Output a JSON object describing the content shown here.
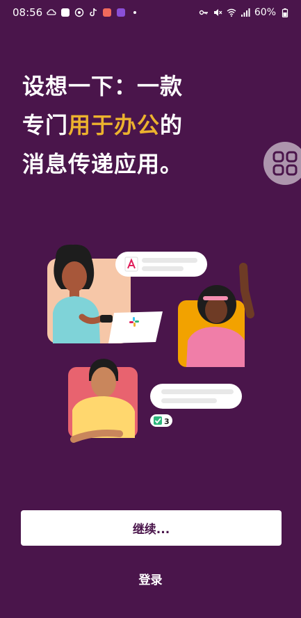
{
  "status_bar": {
    "time": "08:56",
    "battery_percent": "60%",
    "notification_icons": [
      "cloud-icon",
      "mail-icon",
      "chrome-icon",
      "tiktok-icon",
      "app-icon",
      "shield-icon",
      "dot-icon"
    ],
    "system_icons": [
      "key-icon",
      "mute-icon",
      "wifi-icon",
      "signal-icon",
      "battery-icon"
    ]
  },
  "headline": {
    "line1": "设想一下：一款",
    "line2_prefix": "专门",
    "line2_highlight": "用于办公",
    "line2_suffix": "的",
    "line3": "消息传递应用。"
  },
  "illustration": {
    "badge_count": "3"
  },
  "actions": {
    "continue_label": "继续...",
    "signin_label": "登录"
  },
  "colors": {
    "background": "#4A154B",
    "accent": "#ECB22E",
    "button_bg": "#FFFFFF",
    "button_text": "#4A154B"
  }
}
